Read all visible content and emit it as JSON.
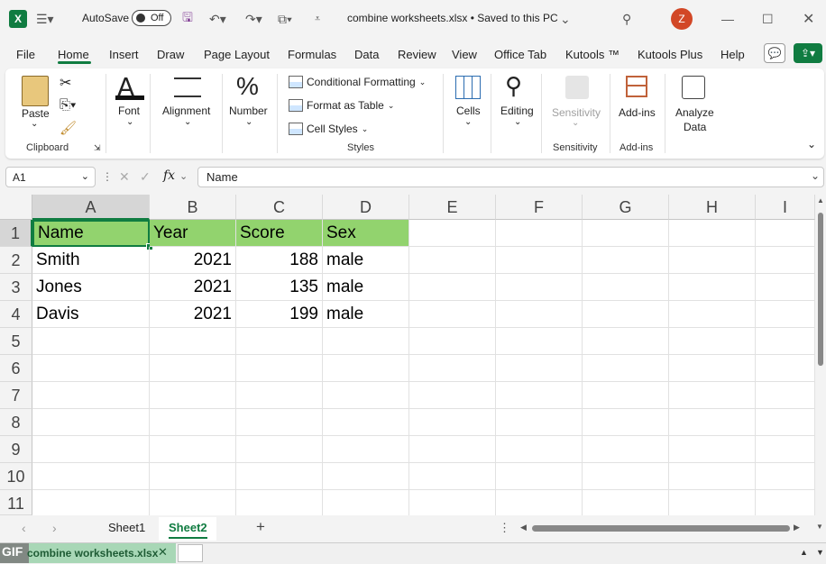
{
  "titlebar": {
    "autosave_label": "AutoSave",
    "autosave_state": "Off",
    "document_title": "combine worksheets.xlsx  •  Saved to this PC",
    "user_initial": "Z"
  },
  "menu": {
    "tabs": [
      "File",
      "Home",
      "Insert",
      "Draw",
      "Page Layout",
      "Formulas",
      "Data",
      "Review",
      "View",
      "Office Tab",
      "Kutools ™",
      "Kutools Plus",
      "Help"
    ],
    "active_tab": "Home"
  },
  "ribbon": {
    "paste": "Paste",
    "clipboard_group": "Clipboard",
    "font": "Font",
    "alignment": "Alignment",
    "number": "Number",
    "conditional_formatting": "Conditional Formatting",
    "format_as_table": "Format as Table",
    "cell_styles": "Cell Styles",
    "styles_group": "Styles",
    "cells": "Cells",
    "editing": "Editing",
    "sensitivity": "Sensitivity",
    "sensitivity_group": "Sensitivity",
    "addins": "Add-ins",
    "addins_group": "Add-ins",
    "analyze_data_1": "Analyze",
    "analyze_data_2": "Data"
  },
  "formula_bar": {
    "name_box": "A1",
    "fx": "fx",
    "formula": "Name"
  },
  "sheet": {
    "columns": [
      "A",
      "B",
      "C",
      "D",
      "E",
      "F",
      "G",
      "H",
      "I"
    ],
    "rows": [
      "1",
      "2",
      "3",
      "4",
      "5",
      "6",
      "7",
      "8",
      "9",
      "10",
      "11"
    ],
    "header": [
      "Name",
      "Year",
      "Score",
      "Sex"
    ],
    "data": [
      [
        "Smith",
        "2021",
        "188",
        "male"
      ],
      [
        "Jones",
        "2021",
        "135",
        "male"
      ],
      [
        "Davis",
        "2021",
        "199",
        "male"
      ]
    ],
    "header_color": "#92d36e",
    "selected_cell": "A1"
  },
  "sheet_tabs": {
    "tabs": [
      "Sheet1",
      "Sheet2"
    ],
    "active": "Sheet2"
  },
  "taskbar": {
    "gif_label": "GIF",
    "tab_label": "combine worksheets.xlsx"
  }
}
